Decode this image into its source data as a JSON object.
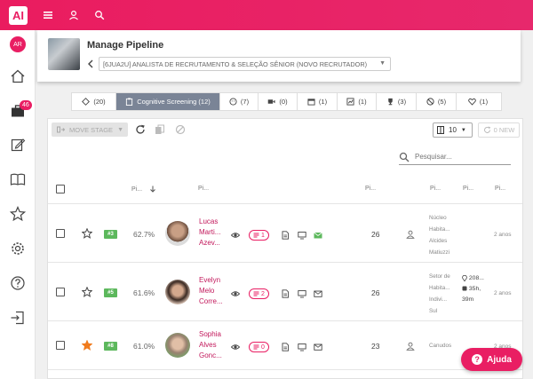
{
  "app": {
    "logo_text": "AI",
    "avatar_initials": "AR",
    "badge_count": "46"
  },
  "colors": {
    "brand": "#e91e63",
    "active_tab": "#7a8496",
    "rank_badge": "#5cb85c"
  },
  "header": {
    "title": "Manage Pipeline",
    "job_select": "[6JUA2U] ANALISTA DE RECRUTAMENTO & SELEÇÃO SÊNIOR (NOVO RECRUTADOR)"
  },
  "tabs": [
    {
      "icon": "diamond-icon",
      "label": "(20)"
    },
    {
      "icon": "clipboard-icon",
      "label": "Cognitive Screening (12)"
    },
    {
      "icon": "face-icon",
      "label": "(7)"
    },
    {
      "icon": "video-icon",
      "label": "(0)"
    },
    {
      "icon": "calendar-icon",
      "label": "(1)"
    },
    {
      "icon": "chart-icon",
      "label": "(1)"
    },
    {
      "icon": "trophy-icon",
      "label": "(3)"
    },
    {
      "icon": "block-icon",
      "label": "(5)"
    },
    {
      "icon": "heart-icon",
      "label": "(1)"
    }
  ],
  "toolbar": {
    "move_stage": "MOVE STAGE",
    "per_page": "10",
    "new_label": "0 NEW",
    "search_placeholder": "Pesquisar..."
  },
  "table": {
    "headers": {
      "fit": "Pi...",
      "name": "Pi...",
      "score": "Pi...",
      "location": "Pi...",
      "travel": "Pi...",
      "experience": "Pi..."
    },
    "rows": [
      {
        "rank": "#3",
        "pct": "62.7%",
        "name_lines": [
          "Lucas",
          "Marti...",
          "Azev..."
        ],
        "comments": "1",
        "score": "26",
        "location_lines": [
          "Núcleo",
          "Habita...",
          "Alcides",
          "Matiuzzi"
        ],
        "travel_lines": [],
        "experience": "2 anos",
        "starred": false
      },
      {
        "rank": "#5",
        "pct": "61.6%",
        "name_lines": [
          "Evelyn",
          "Melo",
          "Corre..."
        ],
        "comments": "2",
        "score": "26",
        "location_lines": [
          "Setor de",
          "Habita...",
          "Indivi...",
          "Sul"
        ],
        "travel_lines": [
          "208...",
          "35h,",
          "39m"
        ],
        "experience": "2 anos",
        "starred": false
      },
      {
        "rank": "#8",
        "pct": "61.0%",
        "name_lines": [
          "Sophia",
          "Alves",
          "Gonc..."
        ],
        "comments": "0",
        "score": "23",
        "location_lines": [
          "Canudos"
        ],
        "travel_lines": [],
        "experience": "2 anos",
        "starred": true
      }
    ]
  },
  "help": {
    "label": "Ajuda"
  }
}
